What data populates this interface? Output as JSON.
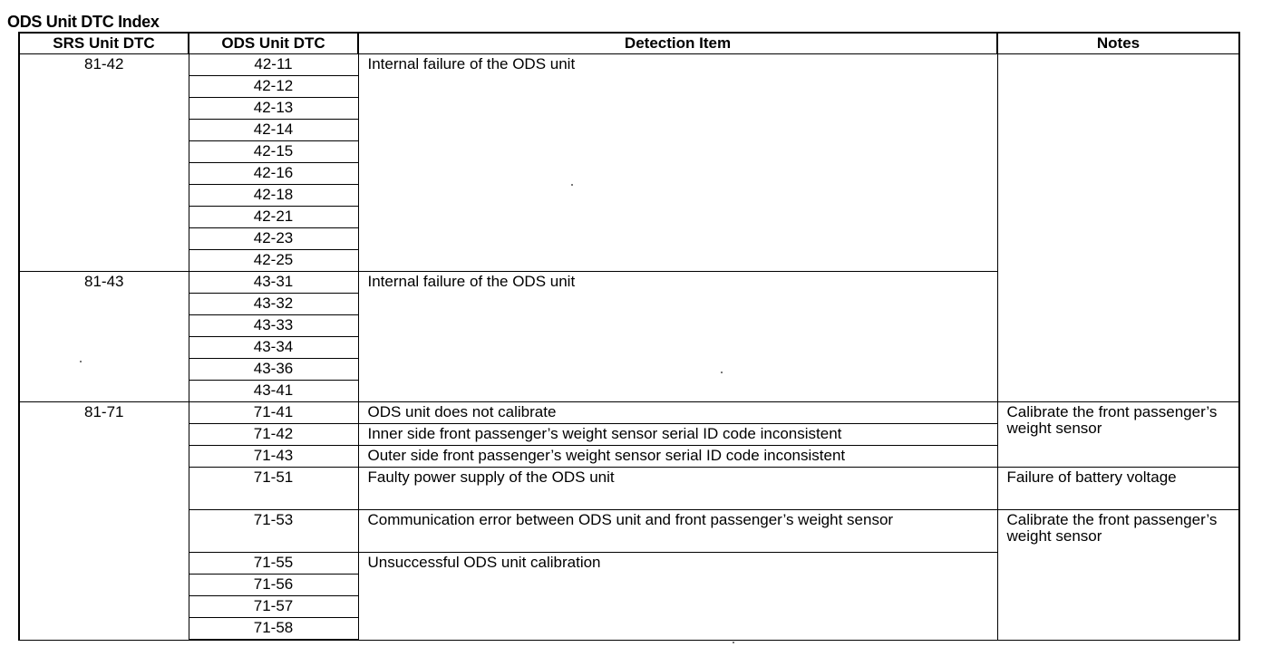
{
  "title": "ODS Unit DTC Index",
  "headers": {
    "srs": "SRS Unit DTC",
    "ods": "ODS Unit DTC",
    "item": "Detection Item",
    "notes": "Notes"
  },
  "srs_codes": [
    "81-42",
    "81-43",
    "81-71"
  ],
  "ods_codes": [
    "42-11",
    "42-12",
    "42-13",
    "42-14",
    "42-15",
    "42-16",
    "42-18",
    "42-21",
    "42-23",
    "42-25",
    "43-31",
    "43-32",
    "43-33",
    "43-34",
    "43-36",
    "43-41",
    "71-41",
    "71-42",
    "71-43",
    "71-51",
    "71-53",
    "71-55",
    "71-56",
    "71-57",
    "71-58"
  ],
  "detection_items": [
    "Internal failure of the ODS unit",
    "Internal failure of the ODS unit",
    "ODS unit does not calibrate",
    "Inner side front passenger’s weight sensor serial ID code inconsistent",
    "Outer side front passenger’s weight sensor serial ID code inconsistent",
    "Faulty power supply of the ODS unit",
    "Communication error between ODS unit and front passenger’s weight sensor",
    "Unsuccessful ODS unit calibration"
  ],
  "notes": [
    "Calibrate the front passenger’s weight sensor",
    "Failure of battery voltage",
    "Calibrate the front passenger’s weight sensor"
  ]
}
